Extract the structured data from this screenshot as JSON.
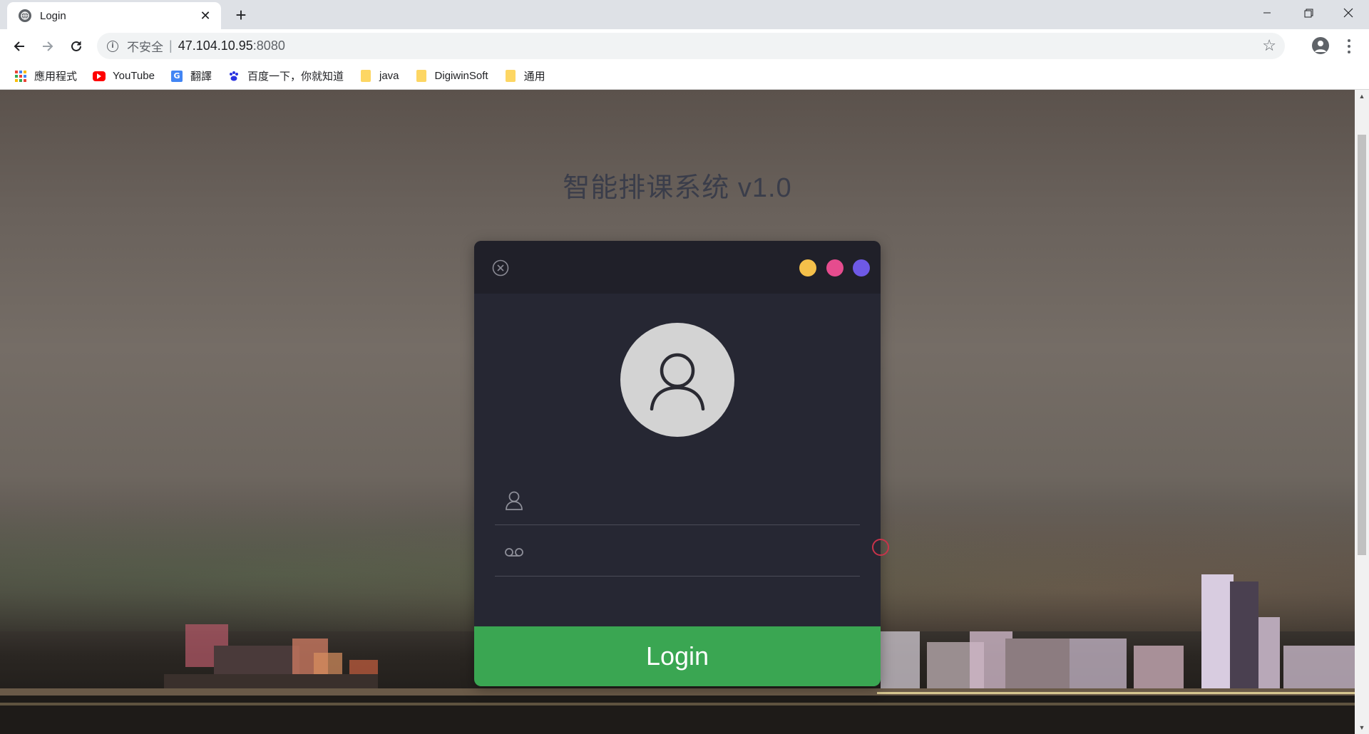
{
  "browser": {
    "tab": {
      "title": "Login",
      "close_glyph": "✕"
    },
    "new_tab_glyph": "+",
    "window_controls": {
      "minimize": "—",
      "restore": "❐",
      "close": "✕"
    },
    "address": {
      "security_label": "不安全",
      "divider": "|",
      "host": "47.104.10.95",
      "port": ":8080"
    },
    "bookmarks": [
      {
        "label": "應用程式",
        "icon": "apps-grid-icon"
      },
      {
        "label": "YouTube",
        "icon": "youtube-icon"
      },
      {
        "label": "翻譯",
        "icon": "translate-icon"
      },
      {
        "label": "百度一下，你就知道",
        "icon": "baidu-paw-icon"
      },
      {
        "label": "java",
        "icon": "folder-icon"
      },
      {
        "label": "DigiwinSoft",
        "icon": "folder-icon"
      },
      {
        "label": "通用",
        "icon": "folder-icon"
      }
    ]
  },
  "page": {
    "title": "智能排课系统 v1.0"
  },
  "login": {
    "dots": [
      {
        "name": "yellow-dot",
        "color": "#f5c04a"
      },
      {
        "name": "pink-dot",
        "color": "#e64c8e"
      },
      {
        "name": "purple-dot",
        "color": "#6e59e6"
      }
    ],
    "username": {
      "value": "",
      "placeholder": ""
    },
    "password": {
      "value": "",
      "placeholder": ""
    },
    "button_label": "Login",
    "button_color": "#3aa652"
  }
}
